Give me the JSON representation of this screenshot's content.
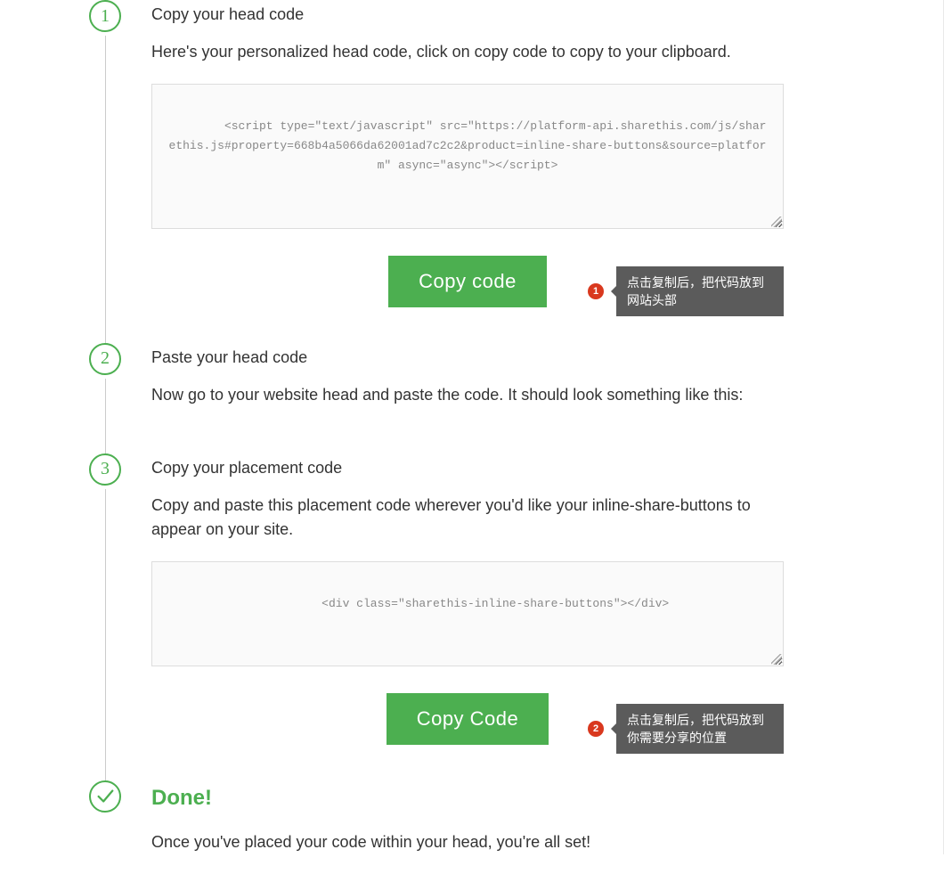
{
  "steps": {
    "step1": {
      "number": "1",
      "title": "Copy your head code",
      "desc": "Here's your personalized head code, click on copy code to copy to your clipboard.",
      "code": "<script type=\"text/javascript\" src=\"https://platform-api.sharethis.com/js/sharethis.js#property=668b4a5066da62001ad7c2c2&product=inline-share-buttons&source=platform\" async=\"async\"></script>",
      "button": "Copy code"
    },
    "step2": {
      "number": "2",
      "title": "Paste your head code",
      "desc": "Now go to your website head and paste the code. It should look something like this:"
    },
    "step3": {
      "number": "3",
      "title": "Copy your placement code",
      "desc": "Copy and paste this placement code wherever you'd like your inline-share-buttons to appear on your site.",
      "code": "<div class=\"sharethis-inline-share-buttons\"></div>",
      "button": "Copy Code"
    },
    "done": {
      "title": "Done!",
      "desc": "Once you've placed your code within your head, you're all set!"
    }
  },
  "annotations": {
    "a1": {
      "num": "1",
      "text": "点击复制后，把代码放到网站头部"
    },
    "a2": {
      "num": "2",
      "text": "点击复制后，把代码放到你需要分享的位置"
    }
  }
}
